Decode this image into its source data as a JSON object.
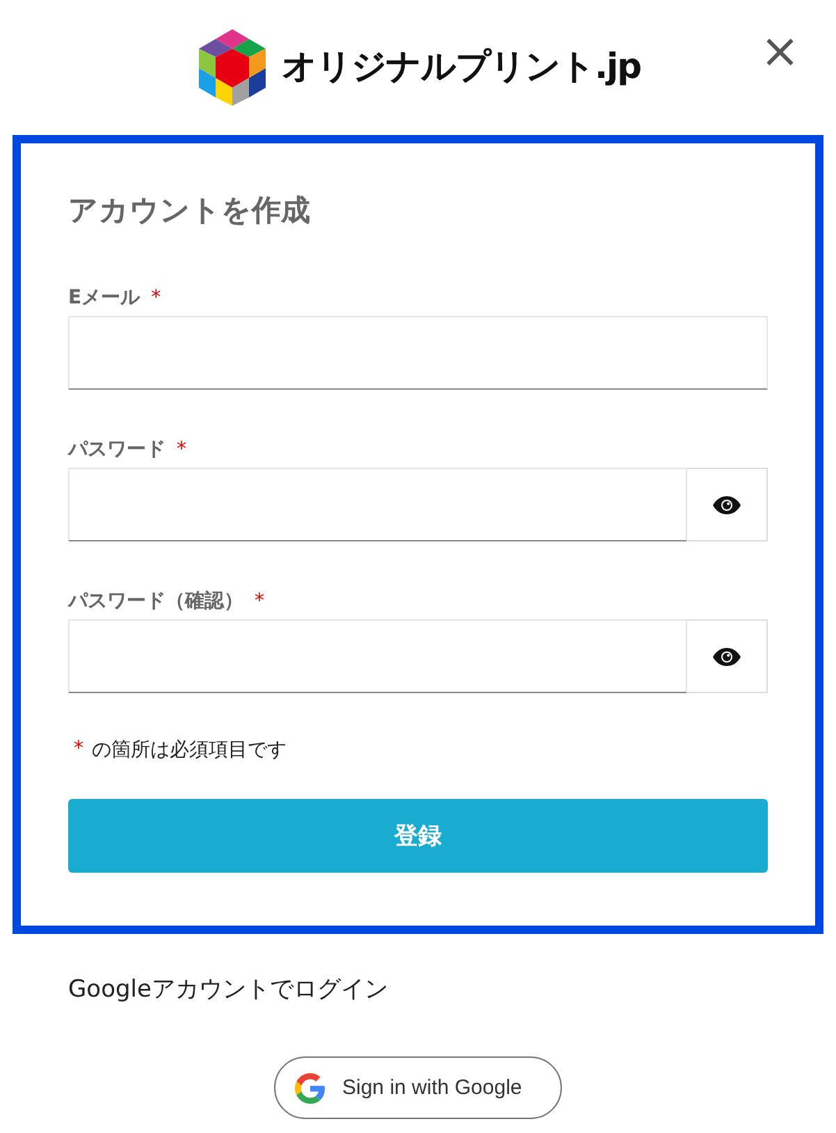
{
  "header": {
    "logo_text": "オリジナルプリント.jp",
    "close": "×"
  },
  "form": {
    "title": "アカウントを作成",
    "fields": [
      {
        "kind": "email",
        "label": "Eメール",
        "required_mark": "*"
      },
      {
        "kind": "password",
        "label": "パスワード",
        "required_mark": "*"
      },
      {
        "kind": "password",
        "label": "パスワード（確認）",
        "required_mark": "*"
      }
    ],
    "note": {
      "mark": "*",
      "text": "の箇所は必須項目です"
    },
    "submit": "登録"
  },
  "google": {
    "caption": "Googleアカウントでログイン",
    "button": "Sign in with Google"
  }
}
